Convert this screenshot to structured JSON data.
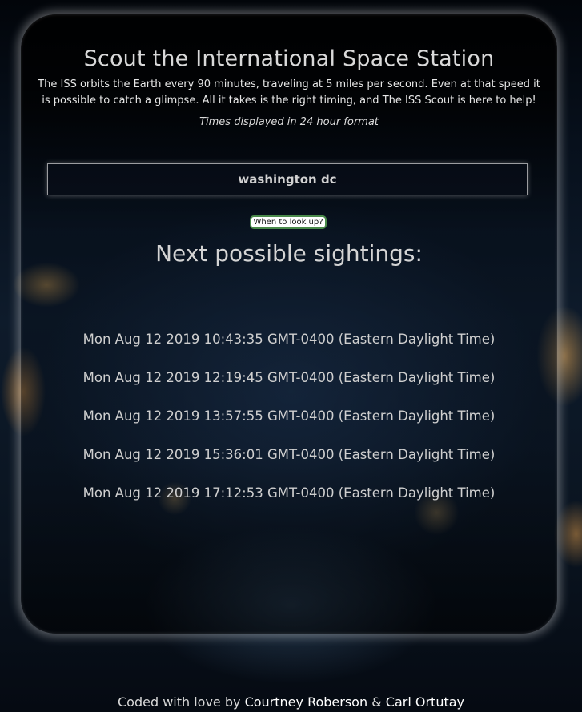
{
  "app": {
    "title": "Scout the International Space Station",
    "intro": "The ISS orbits the Earth every 90 minutes, traveling at 5 miles per second. Even at that speed it is possible to catch a glimpse. All it takes is the right timing, and The ISS Scout is here to help!",
    "time_format_note": "Times displayed in 24 hour format"
  },
  "search": {
    "value": "washington dc"
  },
  "lookup_button_label": "When to look up?",
  "sightings": {
    "heading": "Next possible sightings:",
    "items": [
      "Mon Aug 12 2019 10:43:35 GMT-0400 (Eastern Daylight Time)",
      "Mon Aug 12 2019 12:19:45 GMT-0400 (Eastern Daylight Time)",
      "Mon Aug 12 2019 13:57:55 GMT-0400 (Eastern Daylight Time)",
      "Mon Aug 12 2019 15:36:01 GMT-0400 (Eastern Daylight Time)",
      "Mon Aug 12 2019 17:12:53 GMT-0400 (Eastern Daylight Time)"
    ]
  },
  "footer": {
    "prefix": "Coded with love by",
    "author1": "Courtney Roberson",
    "separator": "&",
    "author2": "Carl Ortutay"
  }
}
